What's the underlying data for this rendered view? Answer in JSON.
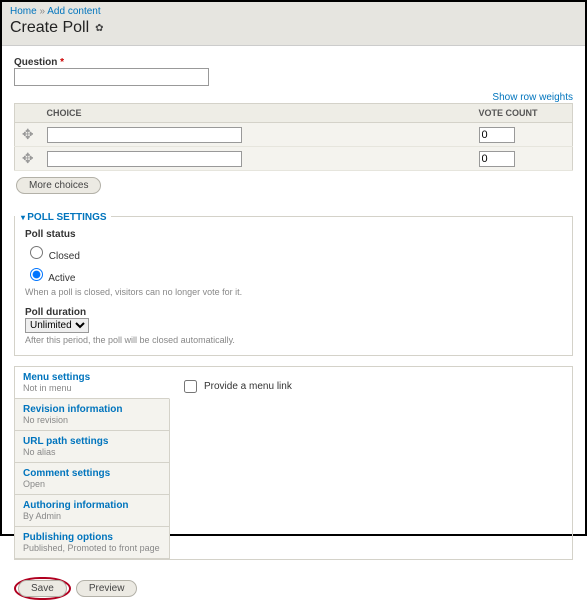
{
  "breadcrumbs": {
    "home": "Home",
    "add": "Add content"
  },
  "page_title": "Create Poll",
  "question": {
    "label": "Question",
    "value": ""
  },
  "row_weights_link": "Show row weights",
  "choices_table": {
    "headers": {
      "choice": "CHOICE",
      "vote": "VOTE COUNT"
    },
    "rows": [
      {
        "choice": "",
        "votes": "0"
      },
      {
        "choice": "",
        "votes": "0"
      }
    ]
  },
  "more_choices_btn": "More choices",
  "poll_settings": {
    "legend": "POLL SETTINGS",
    "status_label": "Poll status",
    "closed_label": "Closed",
    "active_label": "Active",
    "status_value": "active",
    "status_desc": "When a poll is closed, visitors can no longer vote for it.",
    "duration_label": "Poll duration",
    "duration_value": "Unlimited",
    "duration_desc": "After this period, the poll will be closed automatically."
  },
  "vtabs": [
    {
      "title": "Menu settings",
      "sub": "Not in menu"
    },
    {
      "title": "Revision information",
      "sub": "No revision"
    },
    {
      "title": "URL path settings",
      "sub": "No alias"
    },
    {
      "title": "Comment settings",
      "sub": "Open"
    },
    {
      "title": "Authoring information",
      "sub": "By Admin"
    },
    {
      "title": "Publishing options",
      "sub": "Published, Promoted to front page"
    }
  ],
  "menu_pane": {
    "checkbox_label": "Provide a menu link",
    "checked": false
  },
  "actions": {
    "save": "Save",
    "preview": "Preview"
  }
}
